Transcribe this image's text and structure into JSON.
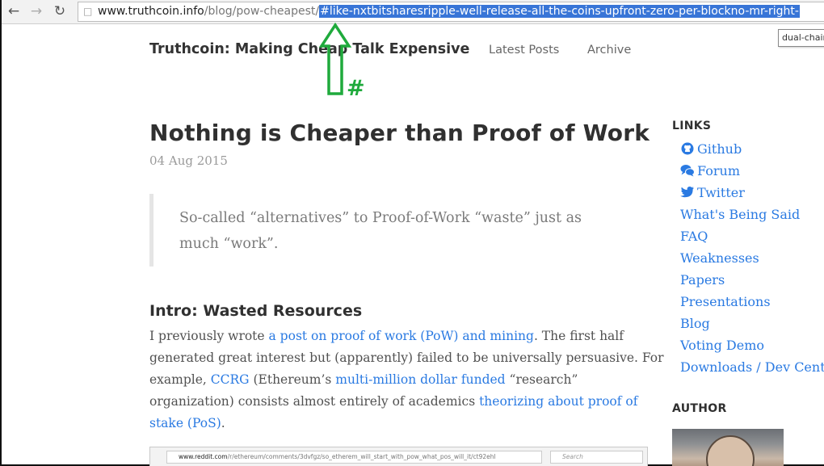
{
  "browser": {
    "url_host": "www.truthcoin.info",
    "url_path": "/blog/pow-cheapest/",
    "url_fragment": "#like-nxtbitsharesripple-well-release-all-the-coins-upfront-zero-per-blockno-mr-right-",
    "autocomplete_text": "dual-chain"
  },
  "header": {
    "site_title": "Truthcoin: Making Cheap Talk Expensive",
    "nav": [
      "Latest Posts",
      "Archive"
    ]
  },
  "annotation": {
    "symbol": "#",
    "color": "#1faa3c"
  },
  "post": {
    "title": "Nothing is Cheaper than Proof of Work",
    "date": "04 Aug 2015",
    "quote_lines": [
      "So-called “alternatives” to Proof-of-Work “waste” just as",
      "much “work”."
    ],
    "section_heading": "Intro: Wasted Resources",
    "para": {
      "l1_pre": "I previously wrote ",
      "l1_link": "a post on proof of work (PoW) and mining",
      "l1_post": ". The first half",
      "l2": "generated great interest but (apparently) failed to be universally persuasive. For",
      "l3_pre": "example, ",
      "l3_link1": "CCRG",
      "l3_mid": " (Ethereum’s ",
      "l3_link2": "multi-million dollar funded",
      "l3_post": " “research”",
      "l4_pre": "organization) consists almost entirely of academics ",
      "l4_link": "theorizing about proof of",
      "l5_link": "stake (PoS)",
      "l5_post": "."
    },
    "embed": {
      "url_host": "www.reddit.com",
      "url_path": "/r/ethereum/comments/3dvfgz/so_etherem_will_start_with_pow_what_pos_will_it/ct92ehl",
      "search_placeholder": "Search"
    }
  },
  "sidebar": {
    "links_heading": "LINKS",
    "links": [
      {
        "label": "Github",
        "icon": "github-icon"
      },
      {
        "label": "Forum",
        "icon": "chat-bubbles-icon"
      },
      {
        "label": "Twitter",
        "icon": "twitter-icon"
      },
      {
        "label": "What's Being Said"
      },
      {
        "label": "FAQ"
      },
      {
        "label": "Weaknesses"
      },
      {
        "label": "Papers"
      },
      {
        "label": "Presentations"
      },
      {
        "label": "Blog"
      },
      {
        "label": "Voting Demo"
      },
      {
        "label": "Downloads / Dev Center"
      }
    ],
    "author_heading": "AUTHOR"
  },
  "colors": {
    "link": "#2a7ae2",
    "url_selection": "#3875d7",
    "heading": "#303030"
  }
}
